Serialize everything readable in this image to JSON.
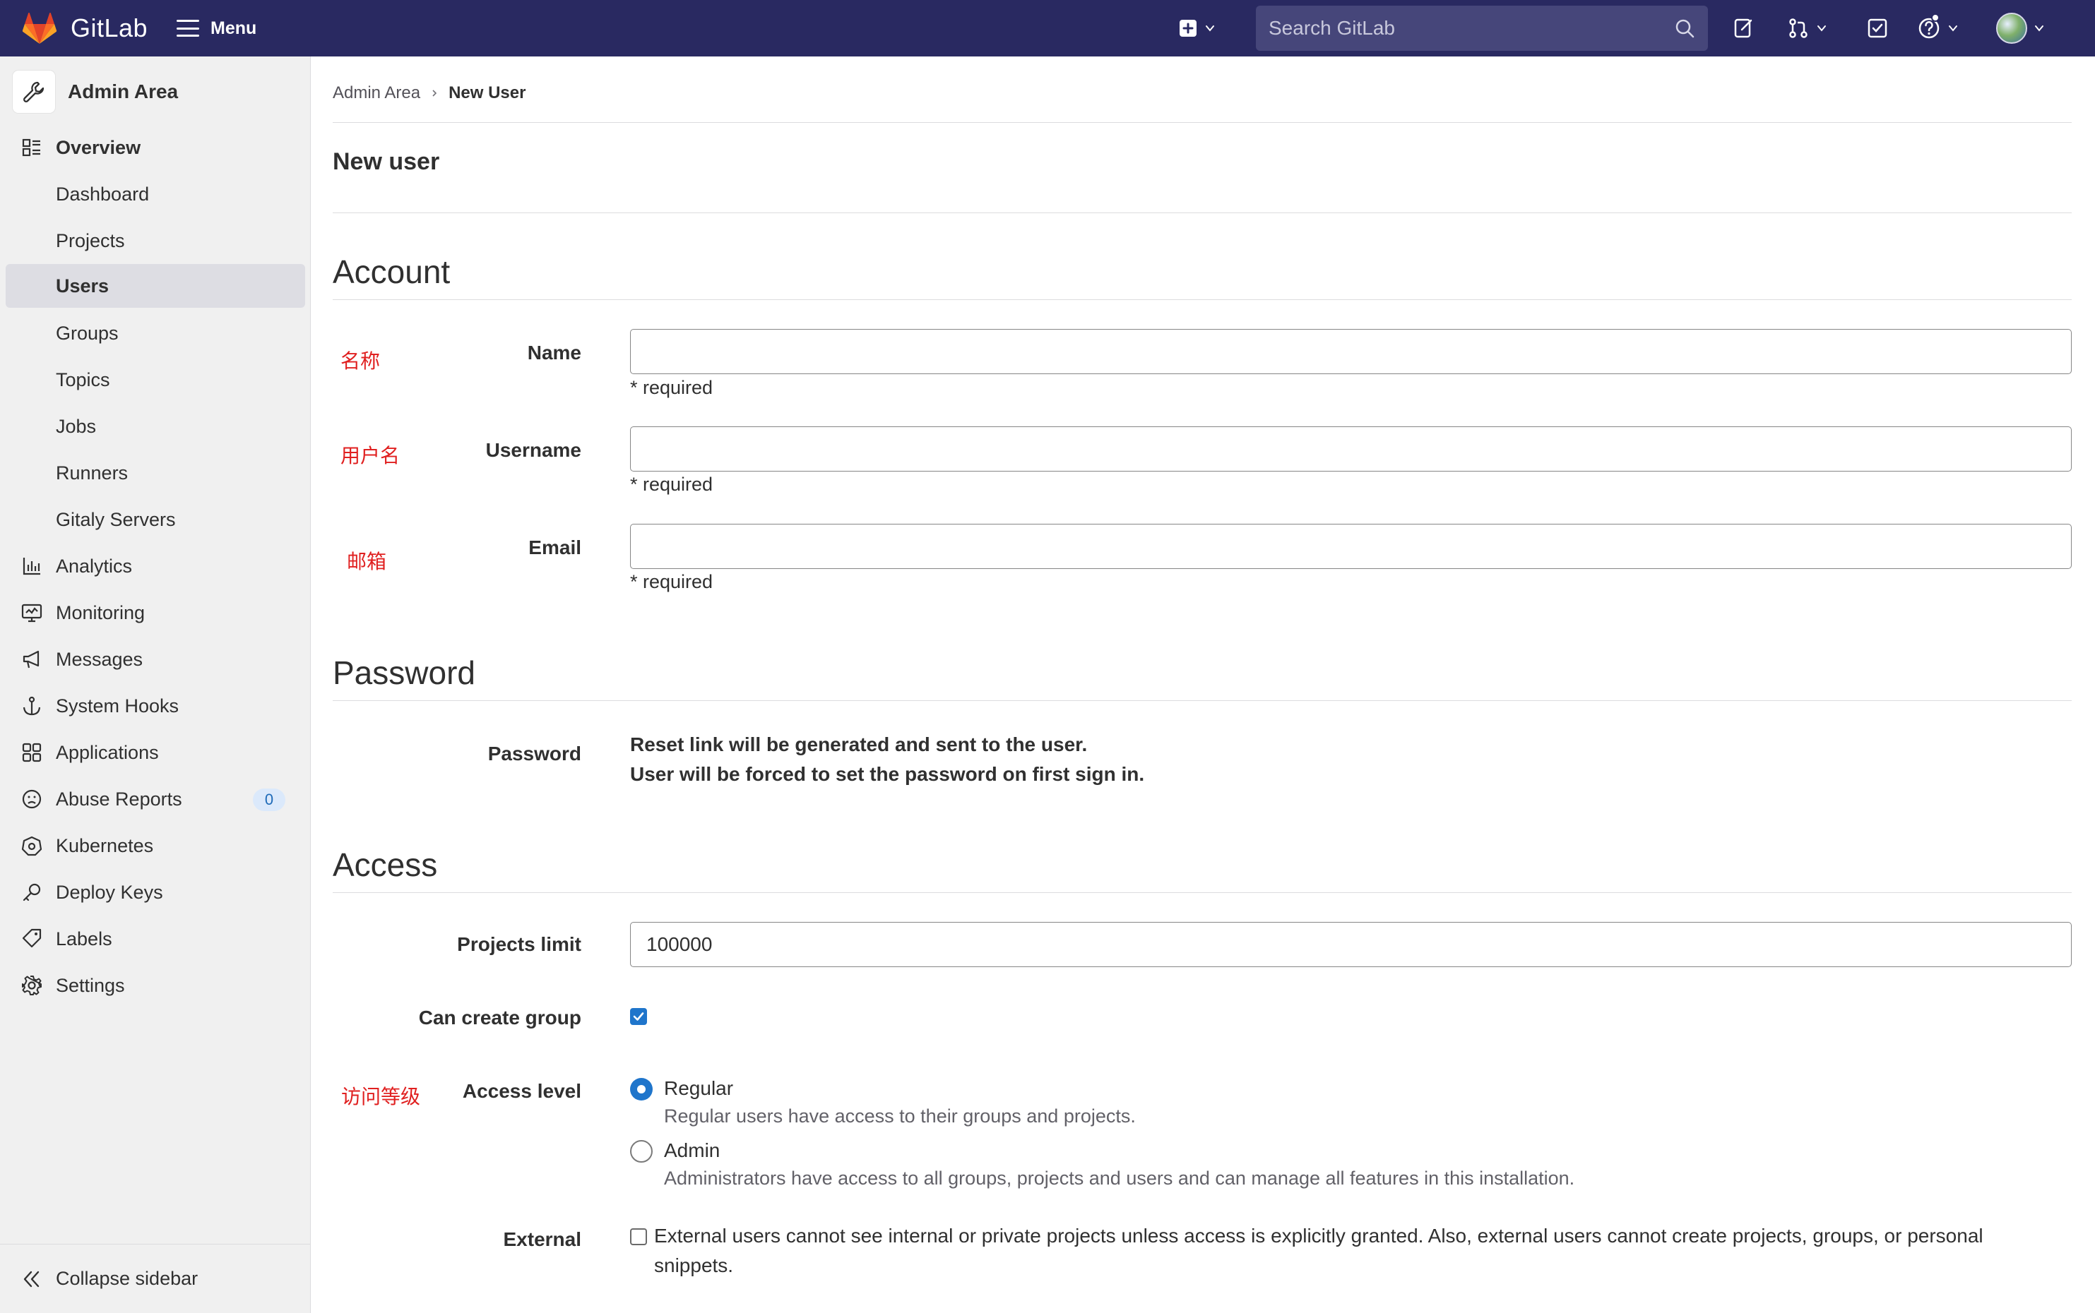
{
  "topbar": {
    "brand": "GitLab",
    "menu_label": "Menu",
    "search_placeholder": "Search GitLab"
  },
  "sidebar": {
    "title": "Admin Area",
    "items": [
      {
        "label": "Overview",
        "icon": "overview-icon",
        "section": true
      },
      {
        "label": "Dashboard"
      },
      {
        "label": "Projects"
      },
      {
        "label": "Users",
        "active": true
      },
      {
        "label": "Groups"
      },
      {
        "label": "Topics"
      },
      {
        "label": "Jobs"
      },
      {
        "label": "Runners"
      },
      {
        "label": "Gitaly Servers"
      },
      {
        "label": "Analytics",
        "icon": "analytics-icon"
      },
      {
        "label": "Monitoring",
        "icon": "monitoring-icon"
      },
      {
        "label": "Messages",
        "icon": "megaphone-icon"
      },
      {
        "label": "System Hooks",
        "icon": "anchor-icon"
      },
      {
        "label": "Applications",
        "icon": "applications-icon"
      },
      {
        "label": "Abuse Reports",
        "icon": "abuse-icon",
        "badge": "0"
      },
      {
        "label": "Kubernetes",
        "icon": "kubernetes-icon"
      },
      {
        "label": "Deploy Keys",
        "icon": "key-icon"
      },
      {
        "label": "Labels",
        "icon": "label-icon"
      },
      {
        "label": "Settings",
        "icon": "settings-icon"
      }
    ],
    "collapse_label": "Collapse sidebar"
  },
  "breadcrumb": {
    "parent": "Admin Area",
    "current": "New User"
  },
  "page_title": "New user",
  "account": {
    "title": "Account",
    "fields": [
      {
        "label": "Name",
        "annotation": "名称",
        "value": "",
        "help": "* required"
      },
      {
        "label": "Username",
        "annotation": "用户名",
        "value": "",
        "help": "* required"
      },
      {
        "label": "Email",
        "annotation": "邮箱",
        "value": "",
        "help": "* required"
      }
    ]
  },
  "password": {
    "title": "Password",
    "label": "Password",
    "line1": "Reset link will be generated and sent to the user.",
    "line2": "User will be forced to set the password on first sign in."
  },
  "access": {
    "title": "Access",
    "projects_limit_label": "Projects limit",
    "projects_limit_value": "100000",
    "can_create_group_label": "Can create group",
    "can_create_group_checked": true,
    "access_level_label": "Access level",
    "access_level_annotation": "访问等级",
    "options": [
      {
        "label": "Regular",
        "help": "Regular users have access to their groups and projects.",
        "selected": true
      },
      {
        "label": "Admin",
        "help": "Administrators have access to all groups, projects and users and can manage all features in this installation.",
        "selected": false
      }
    ],
    "external_label": "External",
    "external_checked": false,
    "external_text": "External users cannot see internal or private projects unless access is explicitly granted. Also, external users cannot create projects, groups, or personal snippets."
  },
  "colors": {
    "navbar": "#292961",
    "accent": "#1f75cb",
    "annotation": "#e02020"
  }
}
